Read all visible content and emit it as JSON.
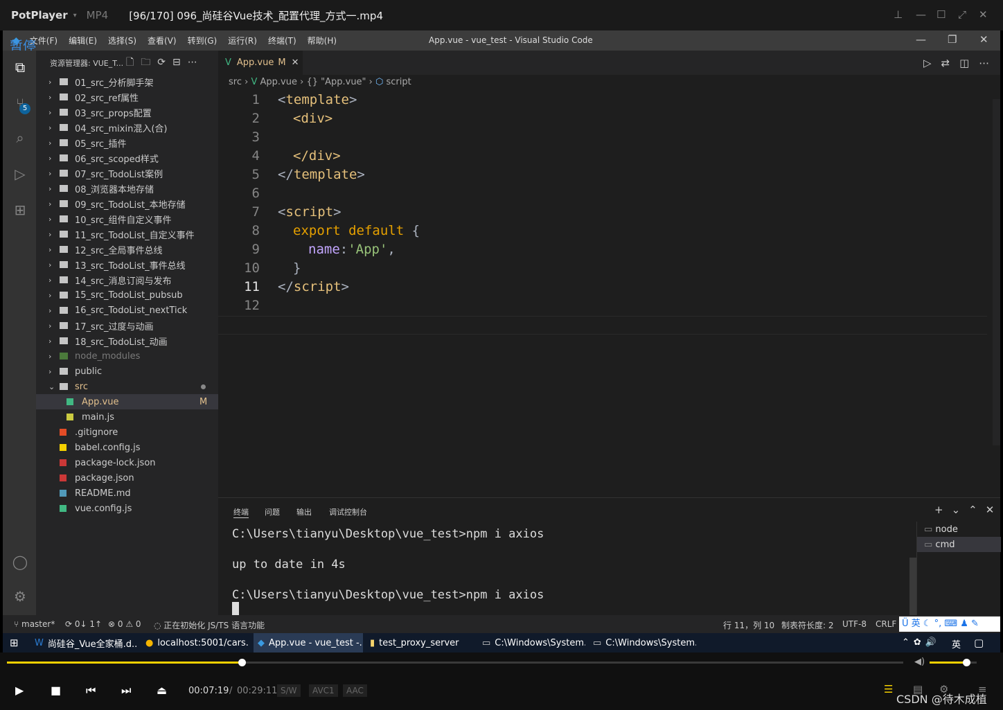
{
  "player": {
    "brand": "PotPlayer",
    "format": "MP4",
    "title": "[96/170] 096_尚硅谷Vue技术_配置代理_方式一.mp4",
    "pause_label": "暂停"
  },
  "menu": [
    "文件(F)",
    "编辑(E)",
    "选择(S)",
    "查看(V)",
    "转到(G)",
    "运行(R)",
    "终端(T)",
    "帮助(H)"
  ],
  "window_title": "App.vue - vue_test - Visual Studio Code",
  "scm_badge": "5",
  "explorer": {
    "title": "资源管理器: VUE_T...",
    "items": [
      "01_src_分析脚手架",
      "02_src_ref属性",
      "03_src_props配置",
      "04_src_mixin混入(合)",
      "05_src_插件",
      "06_src_scoped样式",
      "07_src_TodoList案例",
      "08_浏览器本地存储",
      "09_src_TodoList_本地存储",
      "10_src_组件自定义事件",
      "11_src_TodoList_自定义事件",
      "12_src_全局事件总线",
      "13_src_TodoList_事件总线",
      "14_src_消息订阅与发布",
      "15_src_TodoList_pubsub",
      "16_src_TodoList_nextTick",
      "17_src_过度与动画",
      "18_src_TodoList_动画",
      "node_modules",
      "public",
      "src",
      "App.vue",
      "main.js",
      ".gitignore",
      "babel.config.js",
      "package-lock.json",
      "package.json",
      "README.md",
      "vue.config.js"
    ],
    "modified": "M"
  },
  "tab": {
    "name": "App.vue",
    "flag": "M"
  },
  "breadcrumb": {
    "p1": "src",
    "p2": "App.vue",
    "p3": "{} \"App.vue\"",
    "p4": "script"
  },
  "code": {
    "lines": [
      "1",
      "2",
      "3",
      "4",
      "5",
      "6",
      "7",
      "8",
      "9",
      "10",
      "11",
      "12"
    ],
    "l1a": "<",
    "l1b": "template",
    "l1c": ">",
    "l2": "<div>",
    "l4": "</div>",
    "l5a": "</",
    "l5b": "template",
    "l5c": ">",
    "l7a": "<",
    "l7b": "script",
    "l7c": ">",
    "l8a": "export default",
    "l8b": " {",
    "l9a": "name",
    "l9b": ":",
    "l9c": "'App'",
    "l9d": ",",
    "l10": "}",
    "l11a": "</",
    "l11b": "script",
    "l11c": ">"
  },
  "panel": {
    "tabs": [
      "终端",
      "问题",
      "输出",
      "调试控制台"
    ],
    "terminal": [
      "C:\\Users\\tianyu\\Desktop\\vue_test>npm i axios",
      "up to date in 4s",
      "C:\\Users\\tianyu\\Desktop\\vue_test>npm i axios"
    ],
    "instances": [
      "node",
      "cmd"
    ]
  },
  "status": {
    "branch": "master*",
    "sync": "0↓ 1↑",
    "problems": "⊗ 0 ⚠ 0",
    "init": "正在初始化 JS/TS 语言功能",
    "pos": "行 11，列 10",
    "tab": "制表符长度: 2",
    "enc": "UTF-8",
    "eol": "CRLF",
    "ime": "英"
  },
  "taskbar": {
    "items": [
      "尚硅谷_Vue全家桶.d...",
      "localhost:5001/cars...",
      "App.vue - vue_test -...",
      "test_proxy_server",
      "C:\\Windows\\System...",
      "C:\\Windows\\System..."
    ],
    "ime": "英"
  },
  "controls": {
    "time": "00:07:19",
    "sep": "/",
    "duration": "00:29:11",
    "badges": [
      "S/W",
      "AVC1",
      "AAC"
    ],
    "progress": 0.262,
    "volume": 0.78,
    "watermark": "CSDN @待木成植"
  }
}
